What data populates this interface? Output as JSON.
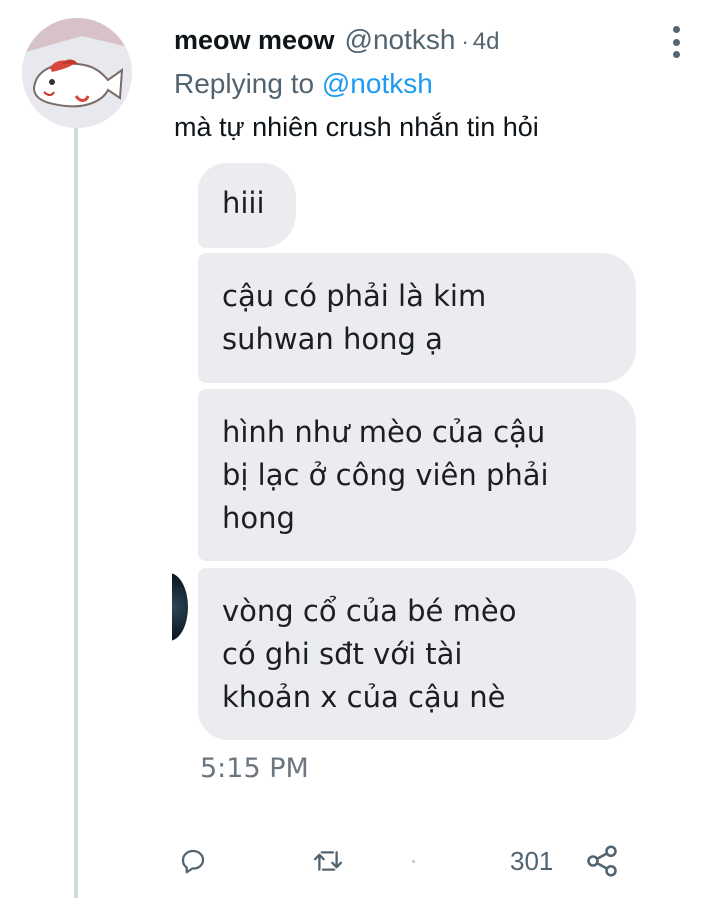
{
  "tweet": {
    "display_name": "meow meow",
    "handle": "@notksh",
    "separator": "·",
    "time_ago": "4d",
    "replying_prefix": "Replying to ",
    "replying_to": "@notksh",
    "text": "mà tự nhiên crush nhắn tin hỏi"
  },
  "media": {
    "messages": [
      "hiii",
      "cậu có phải là kim\nsuhwan hong ạ",
      "hình như mèo của cậu\nbị lạc ở công viên phải\nhong",
      "vòng cổ của bé mèo\ncó ghi sđt với tài\nkhoản x của cậu nè"
    ],
    "timestamp": "5:15 PM"
  },
  "actions": {
    "share_count": "301"
  },
  "icons": {
    "more": "more-vertical-icon",
    "reply": "reply-icon",
    "retweet": "retweet-icon",
    "share": "share-icon"
  },
  "colors": {
    "accent": "#1d9bf0",
    "secondary_text": "#536471",
    "bubble": "#eaecef"
  }
}
